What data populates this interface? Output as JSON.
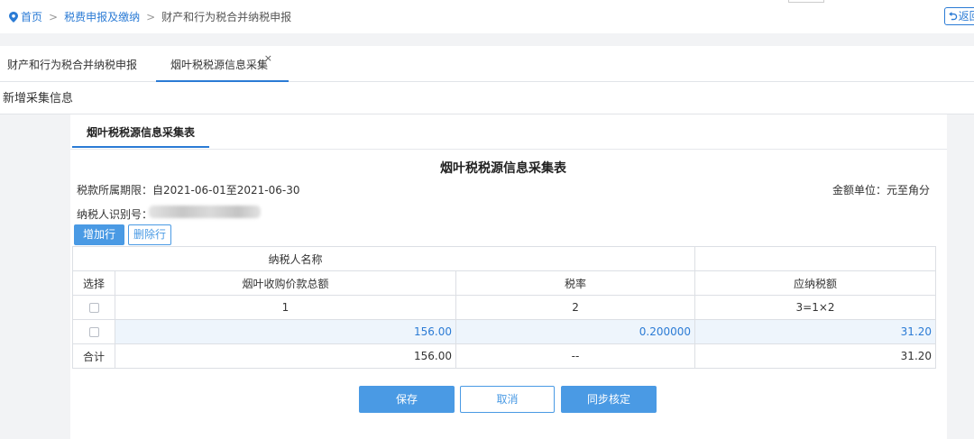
{
  "breadcrumb": {
    "home": "首页",
    "level2": "税费申报及缴纳",
    "current": "财产和行为税合并纳税申报",
    "separator": ">"
  },
  "back_button": {
    "label": "返回",
    "icon": "return-arrow-icon"
  },
  "tabs": [
    {
      "label": "财产和行为税合并纳税申报",
      "active": false
    },
    {
      "label": "烟叶税税源信息采集",
      "active": true,
      "close": "×"
    }
  ],
  "section_title": "新增采集信息",
  "panel": {
    "tab_label": "烟叶税税源信息采集表",
    "form_title": "烟叶税税源信息采集表",
    "period_label": "税款所属期限：自2021-06-01至2021-06-30",
    "unit_label": "金额单位：元至角分",
    "taxpayer_id_label": "纳税人识别号：",
    "add_row": "增加行",
    "delete_row": "删除行"
  },
  "table": {
    "taxpayer_name_label": "纳税人名称",
    "headers": [
      "选择",
      "烟叶收购价款总额",
      "税率",
      "应纳税额"
    ],
    "index_row": [
      "1",
      "2",
      "3=1×2"
    ],
    "rows": [
      {
        "amount": "156.00",
        "rate": "0.200000",
        "tax": "31.20"
      }
    ],
    "total": {
      "label": "合计",
      "amount": "156.00",
      "rate": "--",
      "tax": "31.20"
    }
  },
  "actions": {
    "save": "保存",
    "cancel": "取消",
    "sync": "同步核定"
  },
  "colors": {
    "accent": "#2b7bd5",
    "button": "#4a9ae4",
    "row_highlight": "#eef5fc"
  }
}
